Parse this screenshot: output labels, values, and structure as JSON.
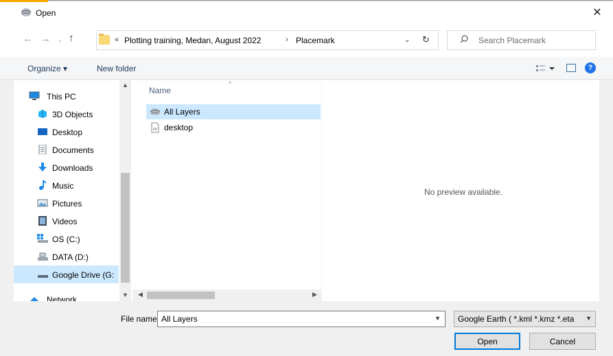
{
  "window": {
    "title": "Open",
    "close_symbol": "✕"
  },
  "navigation": {
    "back": "←",
    "forward": "→",
    "recent": "⌄",
    "up": "↑"
  },
  "address_bar": {
    "overflow": "«",
    "breadcrumbs": [
      "Plotting training, Medan, August 2022",
      "Placemark"
    ],
    "separator": "›",
    "dropdown": "⌄",
    "refresh": "↻"
  },
  "search": {
    "placeholder": "Search Placemark"
  },
  "toolbar": {
    "organize_label": "Organize ▾",
    "new_folder_label": "New folder",
    "help_label": "?"
  },
  "nav_pane": {
    "items": [
      {
        "label": "This PC",
        "icon": "computer-icon",
        "selected": false
      },
      {
        "label": "3D Objects",
        "icon": "cube-icon",
        "selected": false
      },
      {
        "label": "Desktop",
        "icon": "desktop-icon",
        "selected": false
      },
      {
        "label": "Documents",
        "icon": "document-icon",
        "selected": false
      },
      {
        "label": "Downloads",
        "icon": "download-icon",
        "selected": false
      },
      {
        "label": "Music",
        "icon": "music-icon",
        "selected": false
      },
      {
        "label": "Pictures",
        "icon": "pictures-icon",
        "selected": false
      },
      {
        "label": "Videos",
        "icon": "videos-icon",
        "selected": false
      },
      {
        "label": "OS (C:)",
        "icon": "drive-icon",
        "selected": false
      },
      {
        "label": "DATA (D:)",
        "icon": "drive-icon",
        "selected": false
      },
      {
        "label": "Google Drive (G:",
        "icon": "drive-icon",
        "selected": true
      },
      {
        "label": "Network",
        "icon": "network-icon",
        "selected": false
      }
    ]
  },
  "file_list": {
    "column_name": "Name",
    "sort_indicator": "^",
    "files": [
      {
        "name": "All Layers",
        "icon": "layers-icon",
        "selected": true
      },
      {
        "name": "desktop",
        "icon": "file-icon",
        "selected": false
      }
    ]
  },
  "preview": {
    "message": "No preview available."
  },
  "footer": {
    "file_name_label": "File name:",
    "file_name_value": "All Layers",
    "file_type_value": "Google Earth ( *.kml *.kmz *.eta",
    "open_label": "Open",
    "cancel_label": "Cancel"
  },
  "colors": {
    "accent": "#0078d7",
    "selection": "#cce8ff",
    "help_blue": "#1e73e8",
    "title_strip": "#f7a700"
  }
}
